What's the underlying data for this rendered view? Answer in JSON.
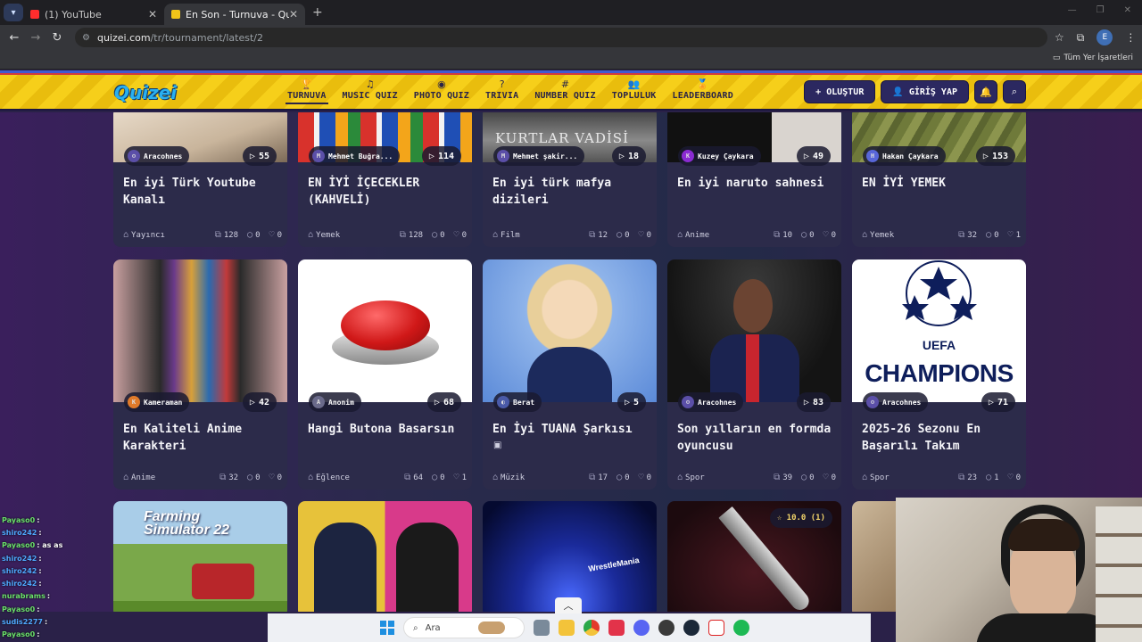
{
  "browser": {
    "tabs": [
      {
        "title": "(1) YouTube",
        "favicon_color": "#ff2d2d",
        "active": false
      },
      {
        "title": "En Son - Turnuva - Quizei",
        "favicon_color": "#f0c419",
        "active": true
      }
    ],
    "url_host": "quizei.com",
    "url_path": "/tr/tournament/latest/2",
    "profile_initial": "E",
    "bookmarks_all": "Tüm Yer İşaretleri"
  },
  "site": {
    "logo": "Quizei",
    "nav": [
      {
        "label": "TURNUVA",
        "icon": "trophy-icon",
        "glyph": "🏆",
        "active": true
      },
      {
        "label": "MUSIC QUIZ",
        "icon": "music-icon",
        "glyph": "♫",
        "active": false
      },
      {
        "label": "PHOTO QUIZ",
        "icon": "camera-icon",
        "glyph": "◉",
        "active": false
      },
      {
        "label": "TRIVIA",
        "icon": "question-icon",
        "glyph": "?",
        "active": false
      },
      {
        "label": "NUMBER QUIZ",
        "icon": "hash-icon",
        "glyph": "#",
        "active": false
      },
      {
        "label": "TOPLULUK",
        "icon": "users-icon",
        "glyph": "👥",
        "active": false
      },
      {
        "label": "LEADERBOARD",
        "icon": "medal-icon",
        "glyph": "🏅",
        "active": false
      }
    ],
    "create_label": "OLUŞTUR",
    "login_label": "GİRİŞ YAP"
  },
  "cards_row1": [
    {
      "author": "Aracohnes",
      "plays": "55",
      "title": "En iyi Türk Youtube Kanalı",
      "category": "Yayıncı",
      "items": "128",
      "comments": "0",
      "likes": "0"
    },
    {
      "author": "Mehmet Buğra...",
      "plays": "114",
      "title": "EN İYİ İÇECEKLER (KAHVELİ)",
      "category": "Yemek",
      "items": "128",
      "comments": "0",
      "likes": "0"
    },
    {
      "author": "Mehmet şakir...",
      "plays": "18",
      "title": "En iyi türk mafya dizileri",
      "category": "Film",
      "items": "12",
      "comments": "0",
      "likes": "0"
    },
    {
      "author": "Kuzey Çaykara",
      "plays": "49",
      "title": "En iyi naruto sahnesi",
      "category": "Anime",
      "items": "10",
      "comments": "0",
      "likes": "0"
    },
    {
      "author": "Hakan Çaykara",
      "plays": "153",
      "title": "EN İYİ YEMEK",
      "category": "Yemek",
      "items": "32",
      "comments": "0",
      "likes": "1"
    }
  ],
  "cards_row2": [
    {
      "author": "Kameraman",
      "plays": "42",
      "title": "En Kaliteli Anime Karakteri",
      "category": "Anime",
      "items": "32",
      "comments": "0",
      "likes": "0"
    },
    {
      "author": "Anonim",
      "plays": "68",
      "title": "Hangi Butona Basarsın",
      "category": "Eğlence",
      "items": "64",
      "comments": "0",
      "likes": "1"
    },
    {
      "author": "Berat",
      "plays": "5",
      "title": "En İyi TUANA Şarkısı",
      "category": "Müzik",
      "items": "17",
      "comments": "0",
      "likes": "0"
    },
    {
      "author": "Aracohnes",
      "plays": "83",
      "title": "Son yılların en formda oyuncusu",
      "category": "Spor",
      "items": "39",
      "comments": "0",
      "likes": "0"
    },
    {
      "author": "Aracohnes",
      "plays": "71",
      "title": "2025-26 Sezonu En Başarılı Takım",
      "category": "Spor",
      "items": "23",
      "comments": "1",
      "likes": "0"
    }
  ],
  "thumb_texts": {
    "kurtlar": "KURTLAR VADİSİ",
    "fs": "Farming Simulator 22",
    "wm": "WrestleMania",
    "ucl1": "UEFA",
    "ucl2": "CHAMPIONS"
  },
  "rating_badge": "☆ 10.0 (1)",
  "taskbar": {
    "search_placeholder": "Ara"
  },
  "chat": [
    {
      "user": "Payaso0",
      "msg": ":",
      "blue": false
    },
    {
      "user": "shiro242",
      "msg": ":",
      "blue": true
    },
    {
      "user": "Payaso0",
      "msg": ": as as",
      "blue": false
    },
    {
      "user": "shiro242",
      "msg": ":",
      "blue": true
    },
    {
      "user": "shiro242",
      "msg": ":",
      "blue": true
    },
    {
      "user": "shiro242",
      "msg": ":",
      "blue": true
    },
    {
      "user": "nurabrams",
      "msg": ":",
      "blue": false
    },
    {
      "user": "Payaso0",
      "msg": ":",
      "blue": false
    },
    {
      "user": "sudis2277",
      "msg": ":",
      "blue": true
    },
    {
      "user": "Payaso0",
      "msg": ":",
      "blue": false
    }
  ]
}
